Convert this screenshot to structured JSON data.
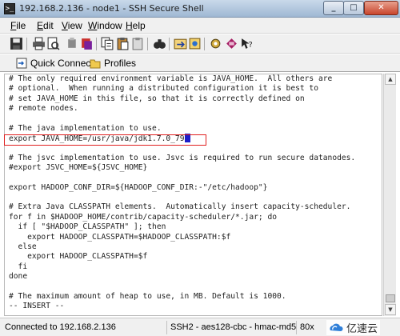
{
  "window": {
    "title": "192.168.2.136 - node1 - SSH Secure Shell",
    "minimize_label": "_",
    "maximize_label": "□",
    "close_label": "✕"
  },
  "menu": {
    "items": [
      "File",
      "Edit",
      "View",
      "Window",
      "Help"
    ]
  },
  "toolbar": {
    "icons": [
      "save-icon",
      "print-icon",
      "print-preview-icon",
      "disconnect-icon",
      "copy-icon",
      "paste-icon",
      "paste-alt-icon",
      "find-icon",
      "file-transfer-icon",
      "new-window-icon",
      "settings-icon",
      "profiles-icon",
      "help-icon"
    ]
  },
  "quickbar": {
    "quick_connect_label": "Quick Connect",
    "profiles_label": "Profiles"
  },
  "terminal": {
    "lines": [
      "# The only required environment variable is JAVA_HOME.  All others are",
      "# optional.  When running a distributed configuration it is best to",
      "# set JAVA_HOME in this file, so that it is correctly defined on",
      "# remote nodes.",
      "",
      "# The java implementation to use.",
      "export JAVA_HOME=/usr/java/jdk1.7.0_79",
      "",
      "# The jsvc implementation to use. Jsvc is required to run secure datanodes.",
      "#export JSVC_HOME=${JSVC_HOME}",
      "",
      "export HADOOP_CONF_DIR=${HADOOP_CONF_DIR:-\"/etc/hadoop\"}",
      "",
      "# Extra Java CLASSPATH elements.  Automatically insert capacity-scheduler.",
      "for f in $HADOOP_HOME/contrib/capacity-scheduler/*.jar; do",
      "  if [ \"$HADOOP_CLASSPATH\" ]; then",
      "    export HADOOP_CLASSPATH=$HADOOP_CLASSPATH:$f",
      "  else",
      "    export HADOOP_CLASSPATH=$f",
      "  fi",
      "done",
      "",
      "# The maximum amount of heap to use, in MB. Default is 1000.",
      "-- INSERT --"
    ],
    "cursor_line": 6
  },
  "status": {
    "connection": "Connected to 192.168.2.136",
    "protocol": "SSH2 - aes128-cbc - hmac-md5",
    "size": "80x"
  },
  "watermark": {
    "text": "亿速云"
  },
  "colors": {
    "highlight_border": "#e02020",
    "cursor": "#1d1dc9"
  }
}
